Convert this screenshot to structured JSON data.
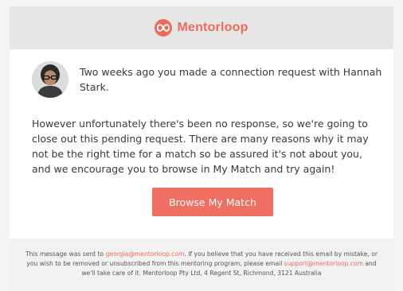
{
  "brand": {
    "name": "Mentorloop",
    "accent": "#ee6a5c",
    "logo_icon": "infinity-icon"
  },
  "intro": {
    "avatar_icon": "user-avatar",
    "text": "Two weeks ago you made a connection request with Hannah Stark."
  },
  "body": {
    "text": "However unfortunately there's been no response, so we're going to close out this pending request. There are many reasons why it may not be the right time for a match so be assured it's not about you, and we encourage you to browse in My Match and try again!"
  },
  "cta": {
    "label": "Browse My Match",
    "color": "#ef6f62"
  },
  "footer": {
    "part1": "This message was sent to ",
    "email": "georgia@mentorloop.com",
    "part2": ". If you believe that you have received this email by mistake, or you wish to be removed or unsubscribed from this mentoring program, please email ",
    "support_email": "support@mentorloop.com",
    "part3": " and we'll take care of it. Mentorloop Pty Ltd, 4 Regent St, Richmond, 3121 Australia"
  }
}
